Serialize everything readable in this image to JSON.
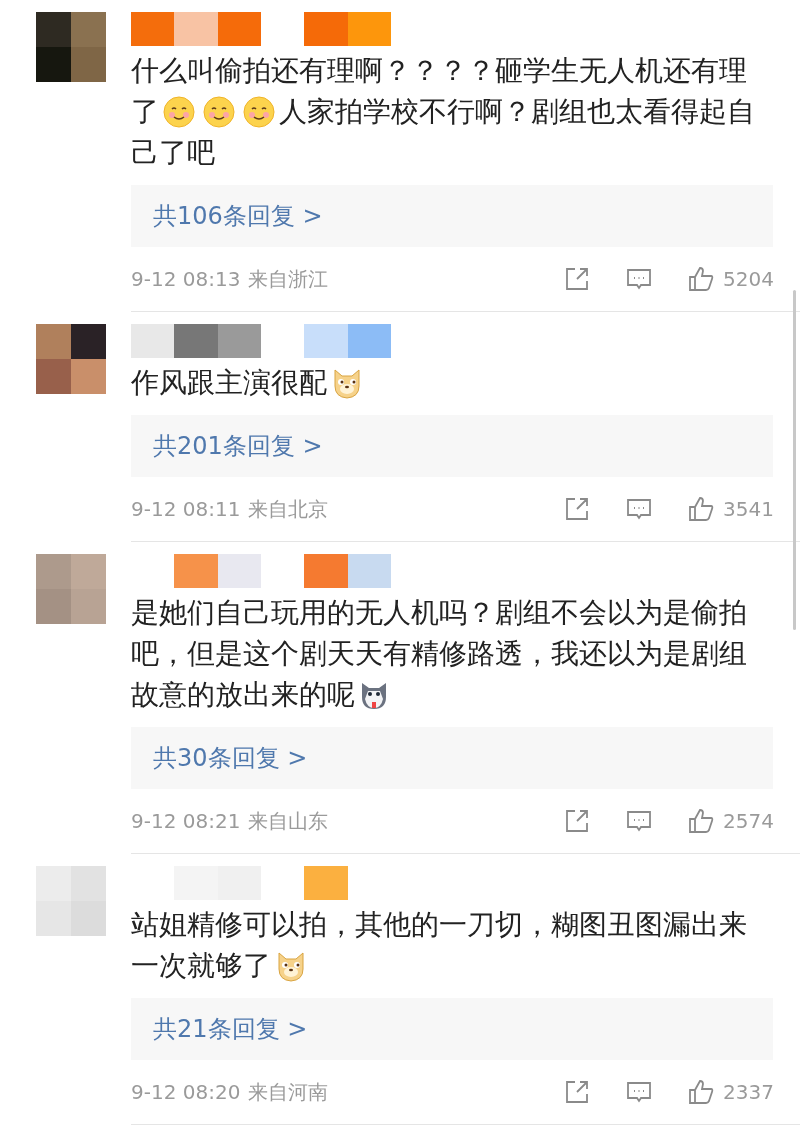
{
  "comments": [
    {
      "lines": [
        [
          {
            "kind": "text",
            "text": "什么叫偷拍还有理啊？？？？砸学生无人机还有理"
          }
        ],
        [
          {
            "kind": "text",
            "text": "了"
          },
          {
            "kind": "smile"
          },
          {
            "kind": "smile"
          },
          {
            "kind": "smile"
          },
          {
            "kind": "text",
            "text": "人家拍学校不行啊？剧组也太看得起自"
          }
        ],
        [
          {
            "kind": "text",
            "text": "己了吧"
          }
        ]
      ],
      "replies": "共106条回复 >",
      "time": "9-12 08:13",
      "location": "来自浙江",
      "likes": "5204"
    },
    {
      "lines": [
        [
          {
            "kind": "text",
            "text": "作风跟主演很配"
          },
          {
            "kind": "doge"
          }
        ]
      ],
      "replies": "共201条回复 >",
      "time": "9-12 08:11",
      "location": "来自北京",
      "likes": "3541"
    },
    {
      "lines": [
        [
          {
            "kind": "text",
            "text": "是她们自己玩用的无人机吗？剧组不会以为是偷拍"
          }
        ],
        [
          {
            "kind": "text",
            "text": "吧，但是这个剧天天有精修路透，我还以为是剧组"
          }
        ],
        [
          {
            "kind": "text",
            "text": "故意的放出来的呢"
          },
          {
            "kind": "husky"
          }
        ]
      ],
      "replies": "共30条回复 >",
      "time": "9-12 08:21",
      "location": "来自山东",
      "likes": "2574"
    },
    {
      "lines": [
        [
          {
            "kind": "text",
            "text": "站姐精修可以拍，其他的一刀切，糊图丑图漏出来"
          }
        ],
        [
          {
            "kind": "text",
            "text": "一次就够了"
          },
          {
            "kind": "doge"
          }
        ]
      ],
      "replies": "共21条回复 >",
      "time": "9-12 08:20",
      "location": "来自河南",
      "likes": "2337"
    }
  ]
}
